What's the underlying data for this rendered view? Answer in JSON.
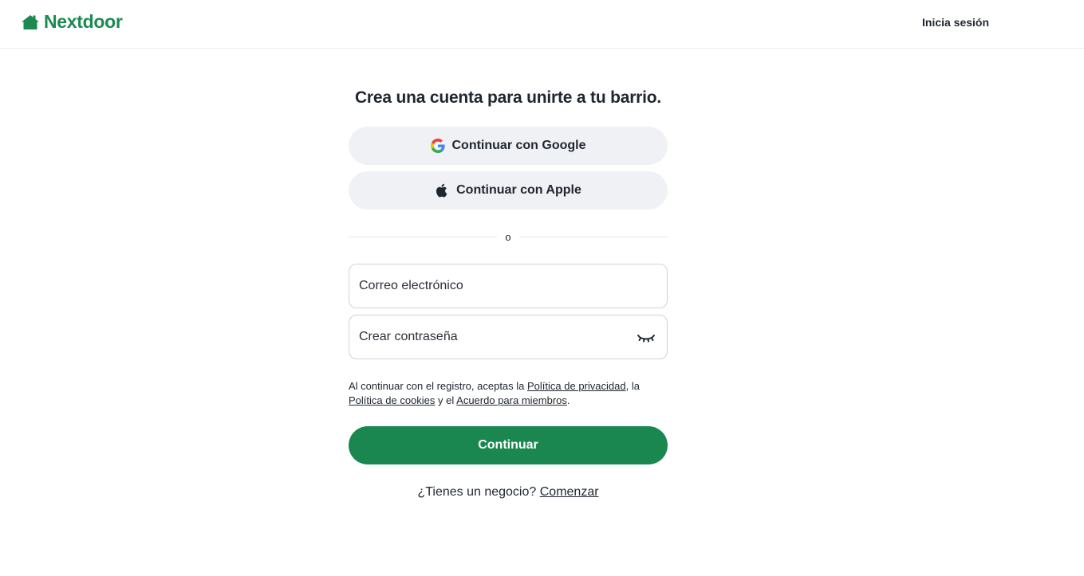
{
  "header": {
    "brand": "Nextdoor",
    "brand_color": "#1b8a50",
    "signin_label": "Inicia sesión"
  },
  "signup": {
    "title": "Crea una cuenta para unirte a tu barrio.",
    "google_label": "Continuar con Google",
    "apple_label": "Continuar con Apple",
    "divider_text": "o",
    "email_placeholder": "Correo electrónico",
    "password_placeholder": "Crear contraseña",
    "legal": {
      "prefix": "Al continuar con el registro, aceptas la ",
      "privacy_link": "Política de privacidad",
      "sep1": ", la ",
      "cookies_link": "Política de cookies",
      "sep2": " y el ",
      "members_link": "Acuerdo para miembros",
      "suffix": "."
    },
    "continue_label": "Continuar",
    "continue_color": "#1a8751",
    "business_question": "¿Tienes un negocio?",
    "business_link": "Comenzar"
  },
  "icons": {
    "logo": "house-icon",
    "google": "google-icon",
    "apple": "apple-icon",
    "password_toggle": "eye-closed-icon"
  }
}
